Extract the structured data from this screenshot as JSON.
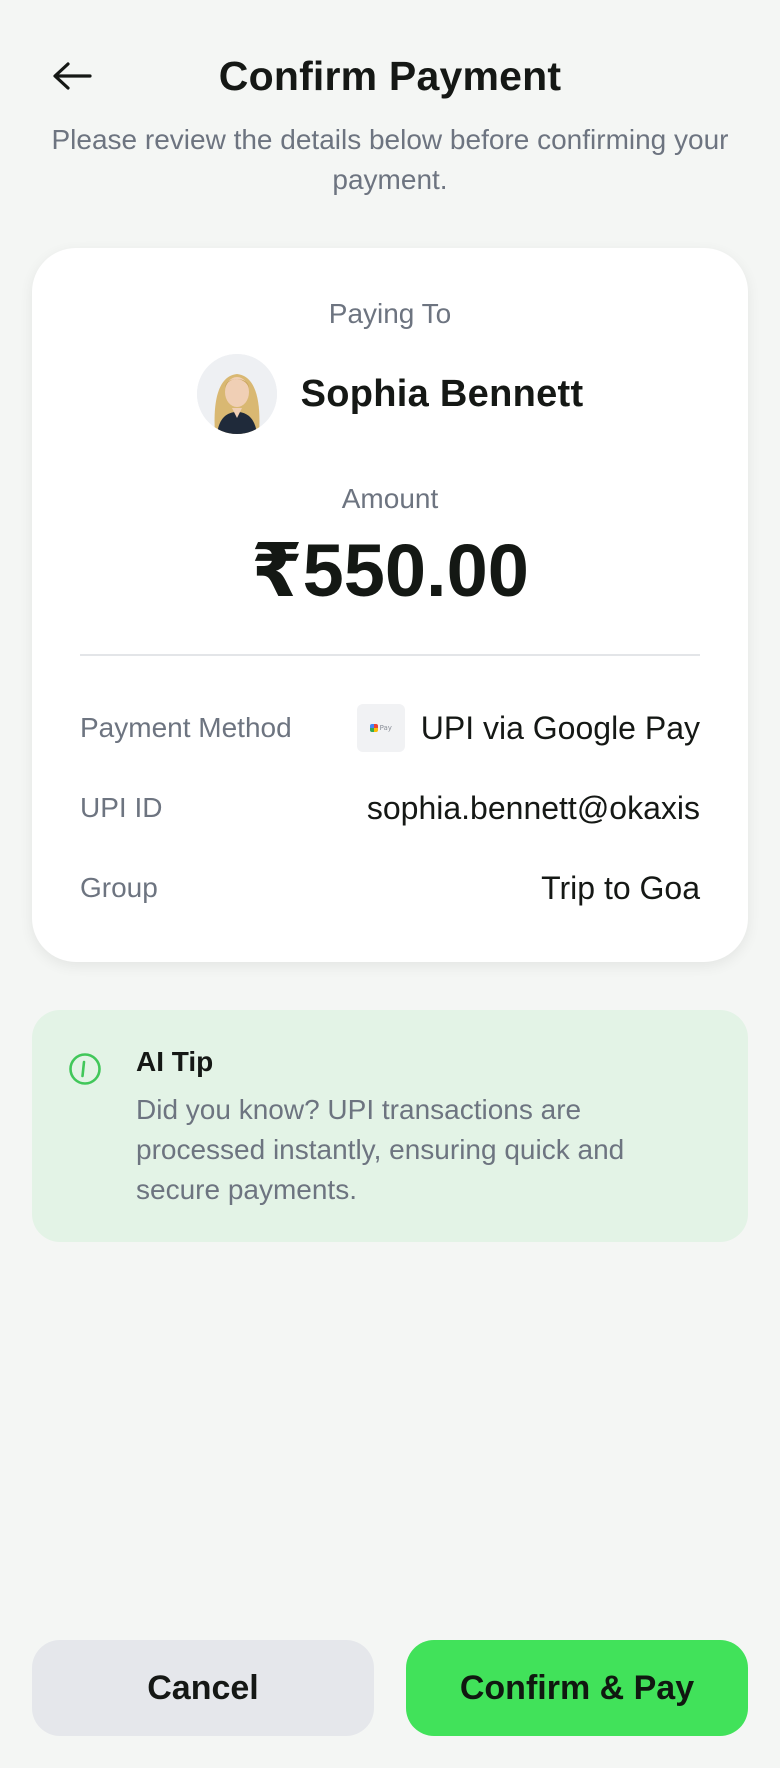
{
  "header": {
    "title": "Confirm Payment",
    "subtitle": "Please review the details below before confirming your payment.",
    "back_icon": "arrow-left-icon"
  },
  "payee": {
    "paying_to_label": "Paying To",
    "name": "Sophia Bennett",
    "avatar_icon": "user-avatar"
  },
  "amount": {
    "label": "Amount",
    "value": "₹550.00"
  },
  "details": {
    "method_label": "Payment Method",
    "method_value": "UPI via Google Pay",
    "method_logo_text": "Pay",
    "upi_label": "UPI ID",
    "upi_value": "sophia.bennett@okaxis",
    "group_label": "Group",
    "group_value": "Trip to Goa"
  },
  "tip": {
    "icon": "info-icon",
    "title": "AI Tip",
    "text": "Did you know? UPI transactions are processed instantly, ensuring quick and secure payments."
  },
  "actions": {
    "cancel_label": "Cancel",
    "confirm_label": "Confirm & Pay"
  },
  "colors": {
    "accent": "#41e25a",
    "background": "#f4f6f4",
    "tip_background": "#e3f3e6",
    "cancel_background": "#e5e7eb"
  }
}
